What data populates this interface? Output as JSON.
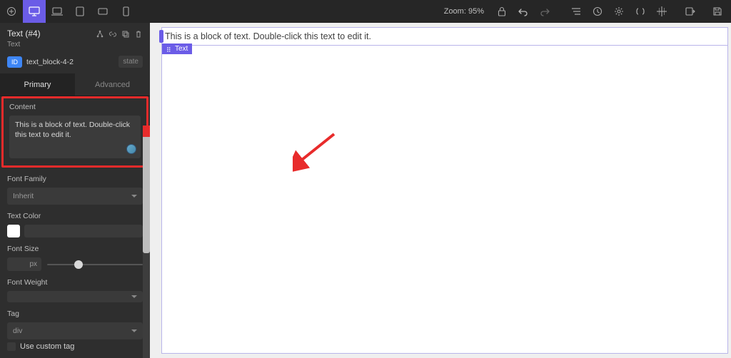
{
  "toolbar": {
    "zoom_label": "Zoom:",
    "zoom_value": "95%"
  },
  "panel": {
    "title": "Text (#4)",
    "type": "Text",
    "id_badge": "ID",
    "id_value": "text_block-4-2",
    "state_label": "state",
    "tabs": {
      "primary": "Primary",
      "advanced": "Advanced"
    },
    "content_label": "Content",
    "content_text": "This is a block of text. Double-click this text to edit it.",
    "font_family_label": "Font Family",
    "font_family_value": "Inherit",
    "text_color_label": "Text Color",
    "text_color_value": "#FFFFFF",
    "font_size_label": "Font Size",
    "font_size_unit": "px",
    "font_weight_label": "Font Weight",
    "font_weight_value": "",
    "tag_label": "Tag",
    "tag_value": "div",
    "use_custom_tag_label": "Use custom tag"
  },
  "canvas": {
    "text": "This is a block of text. Double-click this text to edit it.",
    "chip_label": "Text"
  },
  "colors": {
    "accent": "#6B5CE7",
    "highlight": "#E82B2B"
  }
}
